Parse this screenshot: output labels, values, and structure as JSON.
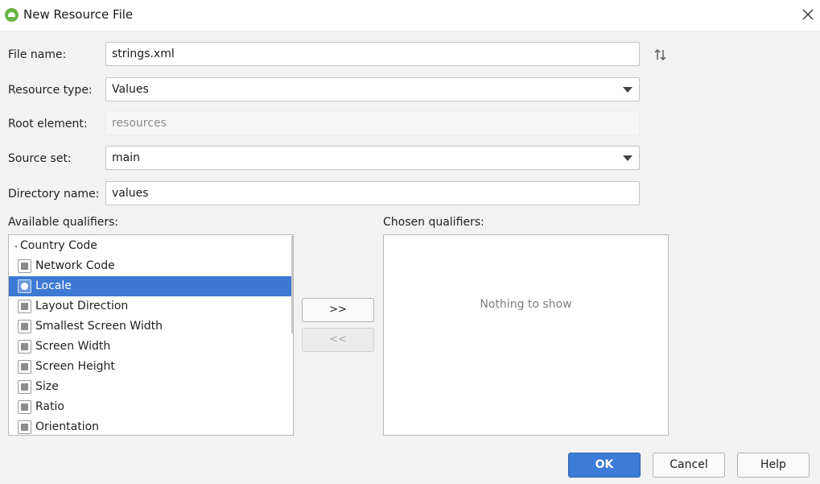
{
  "window": {
    "title": "New Resource File",
    "app_icon": "android-studio-icon",
    "close_icon": "close-icon"
  },
  "form": {
    "file_name": {
      "label": "File name:",
      "value": "strings.xml"
    },
    "resource_type": {
      "label": "Resource type:",
      "value": "Values"
    },
    "root_element": {
      "label": "Root element:",
      "value": "resources"
    },
    "source_set": {
      "label": "Source set:",
      "value": "main"
    },
    "directory_name": {
      "label": "Directory name:",
      "value": "values"
    }
  },
  "qualifiers": {
    "available_label": "Available qualifiers:",
    "chosen_label": "Chosen qualifiers:",
    "chosen_empty": "Nothing to show",
    "add_button": ">>",
    "remove_button": "<<",
    "available": [
      {
        "label": "Country Code",
        "icon": "none"
      },
      {
        "label": "Network Code",
        "icon": "network-code-icon"
      },
      {
        "label": "Locale",
        "icon": "globe-icon",
        "selected": true
      },
      {
        "label": "Layout Direction",
        "icon": "layout-direction-icon"
      },
      {
        "label": "Smallest Screen Width",
        "icon": "smallest-screen-width-icon"
      },
      {
        "label": "Screen Width",
        "icon": "screen-width-icon"
      },
      {
        "label": "Screen Height",
        "icon": "screen-height-icon"
      },
      {
        "label": "Size",
        "icon": "size-icon"
      },
      {
        "label": "Ratio",
        "icon": "ratio-icon"
      },
      {
        "label": "Orientation",
        "icon": "orientation-icon"
      }
    ]
  },
  "buttons": {
    "ok": "OK",
    "cancel": "Cancel",
    "help": "Help"
  },
  "colors": {
    "accent": "#3c7bd6",
    "selection": "#3d79d4",
    "background": "#f2f2f2"
  }
}
